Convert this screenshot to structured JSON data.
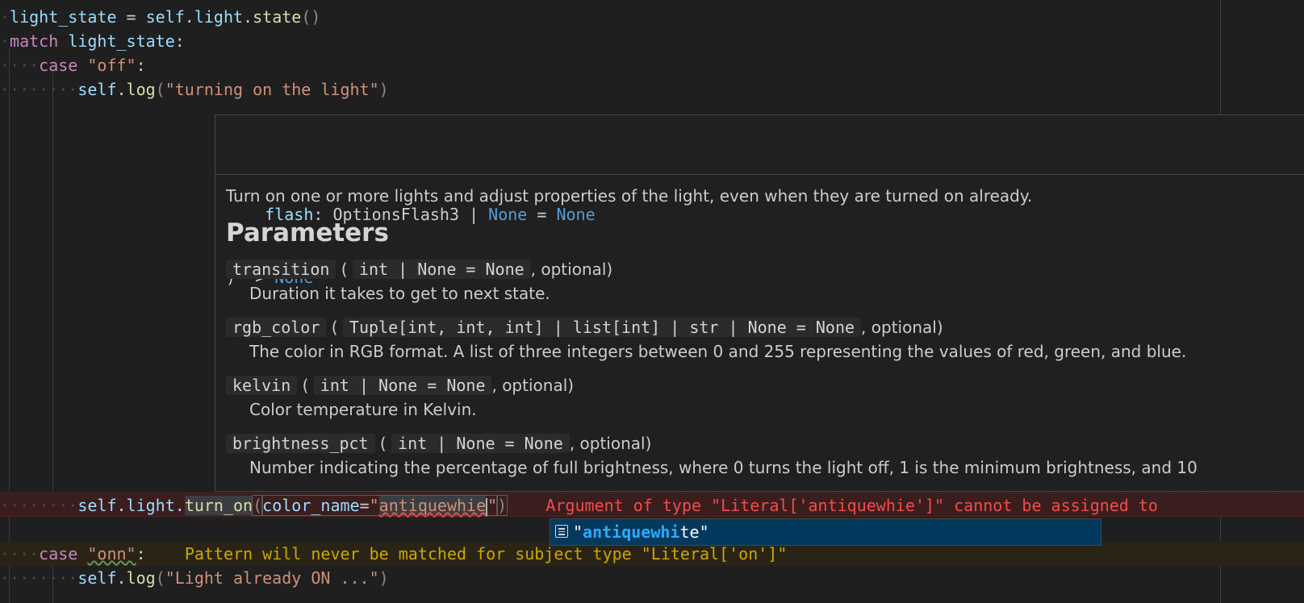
{
  "editor": {
    "line1": {
      "var": "light_state",
      "op": " = ",
      "self": "self",
      "dot": ".",
      "attr": "light",
      "fn": "state",
      "paren": "()"
    },
    "line2": {
      "kw": "match",
      "var": "light_state",
      "colon": ":"
    },
    "line3": {
      "kw": "case",
      "str": "\"off\"",
      "colon": ":"
    },
    "line4": {
      "self": "self",
      "dot": ".",
      "fn": "log",
      "open": "(",
      "str": "\"turning on the light\"",
      "close": ")"
    },
    "line_err": {
      "self": "self",
      "dot1": ".",
      "attr": "light",
      "dot2": ".",
      "fn": "turn_on",
      "open": "(",
      "param": "color_name",
      "eq": "=",
      "q1": "\"",
      "value": "antiquewhie",
      "q2": "\"",
      "close": ")",
      "diagnostic": "Argument of type \"Literal['antiquewhie']\" cannot be assigned to"
    },
    "line_warn": {
      "kw": "case",
      "str": "\"onn\"",
      "colon": ":",
      "diagnostic": "Pattern will never be matched for subject type \"Literal['on']\""
    },
    "line_last": {
      "self": "self",
      "dot": ".",
      "fn": "log",
      "open": "(",
      "str": "\"Light already ON ...\"",
      "close": ")"
    }
  },
  "hover": {
    "sig_partial": "flash",
    "sig_colon": ": ",
    "sig_type": "OptionsFlash3",
    "sig_pipe": " | ",
    "sig_none1": "None",
    "sig_eq": " = ",
    "sig_none2": "None",
    "sig_close": ") -> ",
    "sig_ret": "None",
    "description": "Turn on one or more lights and adjust properties of the light, even when they are turned on already.",
    "heading": "Parameters",
    "params": [
      {
        "name": "transition",
        "type": "int | None = None",
        "optional": ", optional)",
        "open": " ( ",
        "desc": "Duration it takes to get to next state."
      },
      {
        "name": "rgb_color",
        "type": "Tuple[int, int, int] | list[int] | str | None = None",
        "optional": ", optional)",
        "open": " ( ",
        "desc": "The color in RGB format. A list of three integers between 0 and 255 representing the values of red, green, and blue."
      },
      {
        "name": "kelvin",
        "type": "int | None = None",
        "optional": ", optional)",
        "open": " ( ",
        "desc": "Color temperature in Kelvin."
      },
      {
        "name": "brightness_pct",
        "type": "int | None = None",
        "optional": ", optional)",
        "open": " ( ",
        "desc": "Number indicating the percentage of full brightness, where 0 turns the light off, 1 is the minimum brightness, and 10"
      }
    ]
  },
  "suggest": {
    "icon": "value-icon",
    "q_open": "\"",
    "match": "antiquewhi",
    "rest": "te",
    "q_close": "\""
  }
}
